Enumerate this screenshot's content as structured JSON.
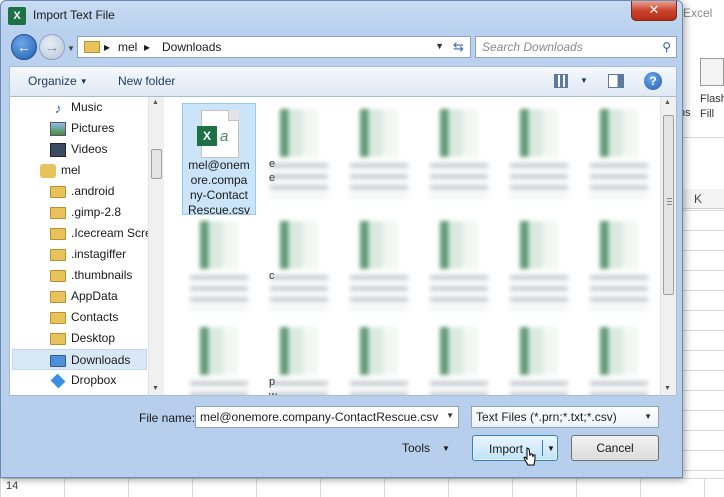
{
  "excel": {
    "title_fragment": "Excel",
    "flash_fill_label": "Flash",
    "flash_fill_label2": "Fill",
    "fragment": "ns",
    "column_k": "K",
    "row_14": "14"
  },
  "dialog": {
    "title": "Import Text File",
    "app_icon": "X",
    "close_symbol": "✕"
  },
  "navigation": {
    "breadcrumb": [
      "mel",
      "Downloads"
    ],
    "search_placeholder": "Search Downloads"
  },
  "toolbar": {
    "organize": "Organize",
    "new_folder": "New folder",
    "help": "?"
  },
  "nav_pane": {
    "items": [
      {
        "label": "Music",
        "icon": "music-icon"
      },
      {
        "label": "Pictures",
        "icon": "pictures-icon"
      },
      {
        "label": "Videos",
        "icon": "videos-icon"
      },
      {
        "label": "mel",
        "icon": "user-folder-icon"
      },
      {
        "label": ".android",
        "icon": "folder-icon"
      },
      {
        "label": ".gimp-2.8",
        "icon": "folder-icon"
      },
      {
        "label": ".Icecream Scre",
        "icon": "folder-icon"
      },
      {
        "label": ".instagiffer",
        "icon": "folder-icon"
      },
      {
        "label": ".thumbnails",
        "icon": "folder-icon"
      },
      {
        "label": "AppData",
        "icon": "folder-icon"
      },
      {
        "label": "Contacts",
        "icon": "folder-icon"
      },
      {
        "label": "Desktop",
        "icon": "folder-icon"
      },
      {
        "label": "Downloads",
        "icon": "downloads-folder-icon",
        "selected": true
      },
      {
        "label": "Dropbox",
        "icon": "dropbox-icon"
      }
    ]
  },
  "files": {
    "selected": {
      "line1": "mel@onem",
      "line2": "ore.compa",
      "line3": "ny-Contact",
      "line4": "Rescue.csv"
    },
    "partial_labels": {
      "r1c2": "e",
      "r1c2b": "e",
      "r2c2": "c",
      "r3c2a": "p",
      "r3c2b": "w"
    }
  },
  "bottom": {
    "file_name_label": "File name:",
    "file_name_value": "mel@onemore.company-ContactRescue.csv",
    "file_type": "Text Files (*.prn;*.txt;*.csv)",
    "tools": "Tools",
    "import": "Import",
    "cancel": "Cancel"
  }
}
